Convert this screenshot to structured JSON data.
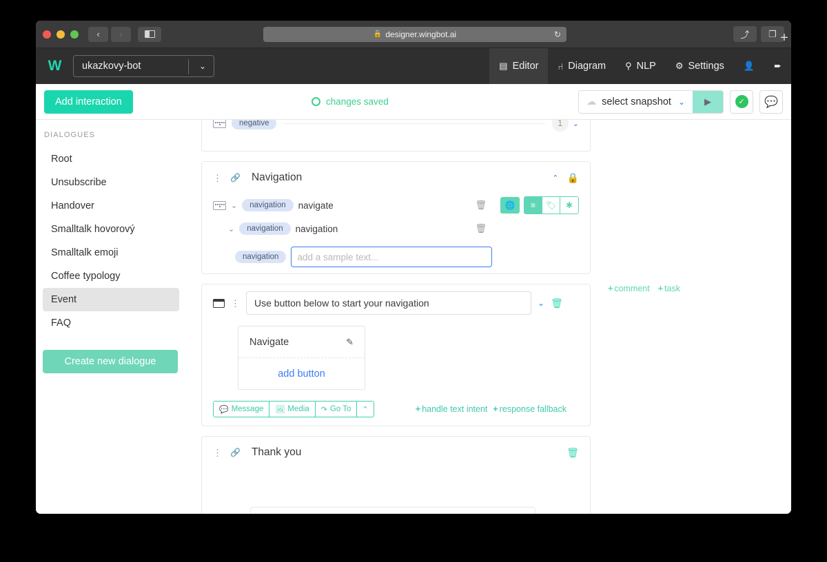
{
  "browser": {
    "url": "designer.wingbot.ai",
    "lock_icon": "lock-icon",
    "back_glyph": "‹",
    "forward_glyph": "›",
    "reload_glyph": "↻",
    "share_glyph": "⤴",
    "tabs_glyph": "❐",
    "newtab_glyph": "+"
  },
  "header": {
    "logo": "W",
    "bot_name": "ukazkovy-bot",
    "chevron": "⌄",
    "nav": [
      {
        "label": "Editor",
        "icon": "editor-icon",
        "glyph": "▤",
        "active": true
      },
      {
        "label": "Diagram",
        "icon": "diagram-icon",
        "glyph": "⑁",
        "active": false
      },
      {
        "label": "NLP",
        "icon": "nlp-icon",
        "glyph": "⚲",
        "active": false
      },
      {
        "label": "Settings",
        "icon": "gear-icon",
        "glyph": "⚙",
        "active": false
      },
      {
        "label": "",
        "icon": "user-icon",
        "glyph": "♟",
        "active": false
      },
      {
        "label": "",
        "icon": "logout-icon",
        "glyph": "⇥",
        "active": false
      }
    ]
  },
  "toolbar": {
    "add_interaction_label": "Add interaction",
    "status_text": "changes saved",
    "snapshot_label": "select snapshot",
    "snapshot_chevron": "⌄",
    "cloud_icon": "cloud-icon",
    "play_glyph": "▶",
    "check_glyph": "✓",
    "comment_glyph": "὞a"
  },
  "sidebar": {
    "title": "DIALOGUES",
    "items": [
      {
        "label": "Root",
        "selected": false
      },
      {
        "label": "Unsubscribe",
        "selected": false
      },
      {
        "label": "Handover",
        "selected": false
      },
      {
        "label": "Smalltalk hovorový",
        "selected": false
      },
      {
        "label": "Smalltalk emoji",
        "selected": false
      },
      {
        "label": "Coffee typology",
        "selected": false
      },
      {
        "label": "Event",
        "selected": true
      },
      {
        "label": "FAQ",
        "selected": false
      }
    ],
    "create_button": "Create new dialogue"
  },
  "content": {
    "partial_card": {
      "chip": "negative",
      "count": "1",
      "chevron": "⌄"
    },
    "navigation_card": {
      "title": "Navigation",
      "dots": "⋮",
      "link_icon": "link-icon",
      "collapse_chevron": "⌃",
      "lock_icon": "lock-icon",
      "rows": [
        {
          "chip": "navigation",
          "text": "navigate",
          "caret": "⌄"
        },
        {
          "chip": "navigation",
          "text": "navigation",
          "caret": "⌄"
        }
      ],
      "input_chip": "navigation",
      "input_placeholder": "add a sample text...",
      "input_value": "",
      "intent_buttons": [
        {
          "name": "globe-icon",
          "glyph": "◐",
          "style": "solo"
        },
        {
          "name": "list-icon",
          "glyph": "≣",
          "style": "filled"
        },
        {
          "name": "tag-icon",
          "glyph": "✐",
          "style": "hollow"
        },
        {
          "name": "asterisk-icon",
          "glyph": "✱",
          "style": "hollow"
        }
      ],
      "trash_icon": "trash-icon",
      "message": {
        "text": "Use button below to start your navigation",
        "chevron": "⌄",
        "trash": "trash-icon",
        "screen_icon": "screen-icon",
        "dots": "⋮",
        "button_label": "Navigate",
        "edit_icon": "edit-icon",
        "add_button_label": "add button"
      },
      "actions": [
        {
          "label": "Message",
          "icon": "message-icon",
          "glyph": "὞a"
        },
        {
          "label": "Media",
          "icon": "media-icon",
          "glyph": "Ὓb"
        },
        {
          "label": "Go To",
          "icon": "goto-icon",
          "glyph": "↱"
        },
        {
          "label": "",
          "icon": "chevron-up-icon",
          "glyph": "⌃"
        }
      ],
      "right_links": [
        {
          "label": "handle text intent",
          "plus": "+"
        },
        {
          "label": "response fallback",
          "plus": "+"
        }
      ]
    },
    "side_actions": [
      {
        "label": "comment",
        "plus": "+"
      },
      {
        "label": "task",
        "plus": "+"
      }
    ],
    "thankyou_card": {
      "title": "Thank you",
      "dots": "⋮",
      "link_icon": "link-icon",
      "trash": "trash-icon"
    }
  },
  "colors": {
    "brand_teal": "#1ad6ae",
    "muted_teal": "#6fd6b8",
    "accent_blue": "#3b7df6",
    "chip_blue_bg": "#dbe4f7",
    "status_green": "#3ecf8e"
  }
}
